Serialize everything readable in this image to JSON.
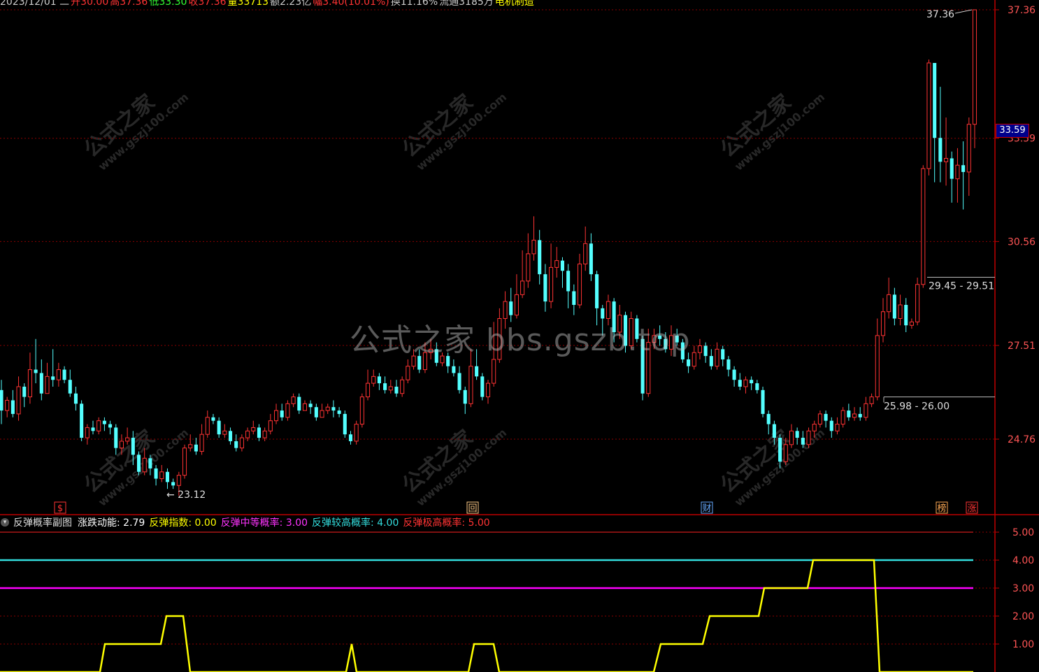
{
  "top_strip": [
    {
      "text": "2023/12/01 二",
      "color": "#cccccc"
    },
    {
      "text": "开30.00",
      "color": "#ff3333"
    },
    {
      "text": "高37.36",
      "color": "#ff3333"
    },
    {
      "text": "低33.30",
      "color": "#33ff33"
    },
    {
      "text": "收37.36",
      "color": "#ff3333"
    },
    {
      "text": "量33713",
      "color": "#ffff00"
    },
    {
      "text": "额2.23亿",
      "color": "#cccccc"
    },
    {
      "text": "幅3.40(10.01%)",
      "color": "#ff3333"
    },
    {
      "text": "换11.16%",
      "color": "#cccccc"
    },
    {
      "text": "流通3185万",
      "color": "#cccccc"
    },
    {
      "text": "电机制造",
      "color": "#ffff00"
    }
  ],
  "watermark": {
    "main": "公式之家 bbs.gszb.top",
    "tile_cn": "公式之家",
    "tile_url": "www.gszj100.com"
  },
  "price_axis": {
    "ticks": [
      "37.36",
      "33.59",
      "30.56",
      "27.51",
      "24.76"
    ],
    "current_price": "33.59"
  },
  "annotations": {
    "high": "37.36",
    "low": "23.12",
    "range_upper": "29.45 - 29.51",
    "range_lower": "25.98 - 26.00"
  },
  "markers": [
    {
      "label": "$",
      "color": "#ff3333"
    },
    {
      "label": "回",
      "color": "#ffcc88"
    },
    {
      "label": "财",
      "color": "#66aaff"
    },
    {
      "label": "榜",
      "color": "#ffaa55"
    },
    {
      "label": "涨",
      "color": "#ff3333"
    }
  ],
  "indicator": {
    "name": "反弹概率副图",
    "items": [
      {
        "label": "涨跌动能:",
        "value": "2.79",
        "color": "#ffffff"
      },
      {
        "label": "反弹指数:",
        "value": "0.00",
        "color": "#ffff00"
      },
      {
        "label": "反弹中等概率:",
        "value": "3.00",
        "color": "#ff33ff"
      },
      {
        "label": "反弹较高概率:",
        "value": "4.00",
        "color": "#33dddd"
      },
      {
        "label": "反弹极高概率:",
        "value": "5.00",
        "color": "#ff3333"
      }
    ],
    "axis_ticks": [
      "5.00",
      "4.00",
      "3.00",
      "2.00",
      "1.00"
    ]
  },
  "colors": {
    "up": "#ff3333",
    "down": "#54ffff",
    "grid": "#8b0000",
    "axis": "#c00000",
    "index_line": "#ffff00",
    "magenta": "#ff00ff",
    "cyan": "#33dddd"
  },
  "chart_data": [
    {
      "type": "candlestick",
      "title": "",
      "ylim": [
        22.2,
        37.7
      ],
      "y_ticks": [
        37.36,
        33.59,
        30.56,
        27.51,
        24.76
      ],
      "grid": true,
      "candles": [
        [
          26.2,
          25.6,
          26.5,
          25.2
        ],
        [
          25.6,
          25.9,
          26.0,
          25.4
        ],
        [
          25.9,
          25.5,
          26.2,
          25.4
        ],
        [
          25.5,
          26.3,
          26.6,
          25.3
        ],
        [
          26.3,
          26.0,
          26.4,
          25.7
        ],
        [
          26.0,
          26.8,
          27.3,
          25.8
        ],
        [
          26.8,
          26.7,
          27.7,
          26.4
        ],
        [
          26.7,
          26.1,
          27.1,
          25.9
        ],
        [
          26.1,
          26.6,
          27.0,
          26.1
        ],
        [
          26.6,
          26.5,
          27.4,
          26.3
        ],
        [
          26.5,
          26.8,
          27.0,
          26.3
        ],
        [
          26.8,
          26.5,
          26.9,
          26.4
        ],
        [
          26.5,
          26.1,
          26.8,
          26.0
        ],
        [
          26.1,
          25.8,
          26.3,
          25.6
        ],
        [
          25.8,
          24.8,
          25.9,
          24.7
        ],
        [
          24.8,
          25.1,
          25.2,
          24.6
        ],
        [
          25.1,
          25.0,
          25.3,
          24.9
        ],
        [
          25.0,
          25.3,
          25.4,
          24.9
        ],
        [
          25.3,
          25.2,
          25.4,
          25.0
        ],
        [
          25.2,
          25.1,
          25.3,
          24.9
        ],
        [
          25.1,
          24.5,
          25.2,
          24.3
        ],
        [
          24.5,
          24.7,
          24.9,
          24.3
        ],
        [
          24.7,
          24.8,
          25.1,
          24.6
        ],
        [
          24.8,
          24.3,
          25.0,
          24.0
        ],
        [
          24.3,
          23.8,
          24.4,
          23.7
        ],
        [
          23.8,
          24.2,
          24.5,
          23.7
        ],
        [
          24.2,
          23.9,
          24.3,
          23.7
        ],
        [
          23.9,
          23.6,
          24.0,
          23.4
        ],
        [
          23.6,
          23.8,
          24.0,
          23.5
        ],
        [
          23.8,
          23.5,
          23.9,
          23.3
        ],
        [
          23.5,
          23.4,
          23.6,
          23.3
        ],
        [
          23.4,
          23.7,
          23.8,
          23.1
        ],
        [
          23.7,
          24.5,
          24.6,
          23.6
        ],
        [
          24.5,
          24.6,
          24.9,
          24.4
        ],
        [
          24.6,
          24.4,
          24.8,
          24.3
        ],
        [
          24.4,
          24.9,
          25.2,
          24.3
        ],
        [
          24.9,
          25.4,
          25.6,
          24.8
        ],
        [
          25.4,
          25.3,
          25.5,
          25.2
        ],
        [
          25.3,
          24.9,
          25.4,
          24.8
        ],
        [
          24.9,
          25.0,
          25.2,
          24.8
        ],
        [
          25.0,
          24.7,
          25.1,
          24.6
        ],
        [
          24.7,
          24.5,
          24.9,
          24.4
        ],
        [
          24.5,
          24.8,
          24.9,
          24.4
        ],
        [
          24.8,
          25.0,
          25.1,
          24.7
        ],
        [
          25.0,
          25.1,
          25.3,
          24.9
        ],
        [
          25.1,
          24.8,
          25.2,
          24.7
        ],
        [
          24.8,
          25.0,
          25.1,
          24.7
        ],
        [
          25.0,
          25.3,
          25.5,
          24.9
        ],
        [
          25.3,
          25.6,
          25.8,
          25.2
        ],
        [
          25.6,
          25.4,
          25.8,
          25.3
        ],
        [
          25.4,
          25.8,
          25.9,
          25.3
        ],
        [
          25.8,
          26.0,
          26.1,
          25.7
        ],
        [
          26.0,
          25.6,
          26.1,
          25.5
        ],
        [
          25.6,
          25.8,
          25.9,
          25.6
        ],
        [
          25.8,
          25.7,
          25.9,
          25.5
        ],
        [
          25.7,
          25.4,
          25.8,
          25.3
        ],
        [
          25.4,
          25.6,
          25.8,
          25.4
        ],
        [
          25.6,
          25.7,
          25.8,
          25.5
        ],
        [
          25.7,
          25.6,
          25.9,
          25.4
        ],
        [
          25.6,
          25.5,
          25.7,
          25.4
        ],
        [
          25.5,
          24.9,
          25.6,
          24.8
        ],
        [
          24.9,
          24.7,
          25.0,
          24.6
        ],
        [
          24.7,
          25.2,
          25.3,
          24.6
        ],
        [
          25.2,
          26.0,
          26.1,
          25.1
        ],
        [
          26.0,
          26.4,
          26.8,
          25.9
        ],
        [
          26.4,
          26.6,
          26.8,
          26.3
        ],
        [
          26.6,
          26.4,
          26.7,
          26.2
        ],
        [
          26.4,
          26.2,
          26.6,
          26.1
        ],
        [
          26.2,
          26.3,
          26.5,
          26.1
        ],
        [
          26.3,
          26.1,
          26.5,
          26.0
        ],
        [
          26.1,
          26.5,
          26.6,
          26.0
        ],
        [
          26.5,
          26.9,
          27.1,
          26.4
        ],
        [
          26.9,
          27.2,
          27.4,
          26.8
        ],
        [
          27.2,
          26.8,
          27.4,
          26.7
        ],
        [
          26.8,
          27.3,
          27.6,
          26.7
        ],
        [
          27.3,
          27.4,
          27.7,
          27.1
        ],
        [
          27.4,
          27.0,
          27.6,
          26.9
        ],
        [
          27.0,
          27.2,
          27.3,
          26.9
        ],
        [
          27.2,
          26.9,
          27.3,
          26.7
        ],
        [
          26.9,
          26.7,
          27.1,
          26.6
        ],
        [
          26.7,
          26.2,
          26.9,
          26.1
        ],
        [
          26.2,
          25.8,
          26.3,
          25.5
        ],
        [
          25.8,
          26.9,
          27.4,
          25.7
        ],
        [
          26.9,
          26.6,
          27.4,
          26.5
        ],
        [
          26.6,
          26.0,
          26.7,
          25.9
        ],
        [
          26.0,
          26.4,
          26.5,
          25.8
        ],
        [
          26.4,
          27.1,
          28.2,
          26.3
        ],
        [
          27.1,
          28.3,
          28.6,
          27.0
        ],
        [
          28.3,
          28.8,
          29.1,
          28.0
        ],
        [
          28.8,
          28.4,
          29.2,
          28.2
        ],
        [
          28.4,
          29.0,
          29.6,
          28.3
        ],
        [
          29.0,
          29.4,
          30.3,
          28.9
        ],
        [
          29.4,
          30.2,
          30.8,
          29.2
        ],
        [
          30.2,
          30.6,
          31.3,
          30.0
        ],
        [
          30.6,
          29.6,
          30.9,
          29.3
        ],
        [
          29.6,
          28.8,
          29.9,
          28.5
        ],
        [
          28.8,
          29.8,
          30.5,
          28.6
        ],
        [
          29.8,
          30.0,
          30.4,
          29.5
        ],
        [
          30.0,
          29.7,
          30.1,
          29.2
        ],
        [
          29.7,
          29.1,
          29.9,
          28.6
        ],
        [
          29.1,
          28.7,
          29.3,
          28.4
        ],
        [
          28.7,
          29.9,
          30.2,
          28.6
        ],
        [
          29.9,
          30.5,
          31.0,
          29.7
        ],
        [
          30.5,
          29.6,
          30.8,
          29.4
        ],
        [
          29.6,
          28.6,
          29.7,
          28.1
        ],
        [
          28.6,
          28.3,
          28.7,
          27.8
        ],
        [
          28.3,
          28.8,
          29.0,
          28.1
        ],
        [
          28.8,
          27.9,
          28.9,
          27.6
        ],
        [
          27.9,
          28.4,
          28.7,
          27.7
        ],
        [
          28.4,
          27.5,
          28.5,
          27.3
        ],
        [
          27.5,
          28.3,
          28.5,
          27.4
        ],
        [
          28.3,
          27.7,
          28.4,
          27.6
        ],
        [
          27.7,
          26.1,
          27.8,
          25.9
        ],
        [
          26.1,
          27.6,
          28.0,
          26.0
        ],
        [
          27.6,
          27.8,
          28.0,
          27.4
        ],
        [
          27.8,
          27.7,
          28.1,
          27.5
        ],
        [
          27.7,
          27.4,
          27.9,
          27.3
        ],
        [
          27.4,
          27.8,
          28.1,
          27.2
        ],
        [
          27.8,
          27.6,
          28.0,
          27.5
        ],
        [
          27.6,
          27.1,
          27.7,
          27.0
        ],
        [
          27.1,
          26.9,
          27.3,
          26.7
        ],
        [
          26.9,
          27.3,
          27.5,
          26.8
        ],
        [
          27.3,
          27.5,
          27.7,
          27.1
        ],
        [
          27.5,
          27.2,
          27.6,
          27.0
        ],
        [
          27.2,
          26.9,
          27.4,
          26.8
        ],
        [
          26.9,
          27.4,
          27.6,
          26.8
        ],
        [
          27.4,
          27.1,
          27.5,
          26.9
        ],
        [
          27.1,
          26.8,
          27.2,
          26.6
        ],
        [
          26.8,
          26.5,
          26.9,
          26.3
        ],
        [
          26.5,
          26.3,
          26.7,
          26.2
        ],
        [
          26.3,
          26.5,
          26.6,
          26.1
        ],
        [
          26.5,
          26.4,
          26.6,
          26.2
        ],
        [
          26.4,
          26.2,
          26.5,
          26.1
        ],
        [
          26.2,
          25.5,
          26.3,
          25.4
        ],
        [
          25.5,
          25.2,
          25.6,
          24.9
        ],
        [
          25.2,
          24.8,
          25.3,
          24.6
        ],
        [
          24.8,
          24.1,
          24.9,
          23.9
        ],
        [
          24.1,
          24.6,
          24.8,
          24.0
        ],
        [
          24.6,
          25.0,
          25.2,
          24.5
        ],
        [
          25.0,
          24.8,
          25.1,
          24.6
        ],
        [
          24.8,
          24.6,
          25.0,
          24.5
        ],
        [
          24.6,
          25.0,
          25.1,
          24.5
        ],
        [
          25.0,
          25.2,
          25.3,
          24.8
        ],
        [
          25.2,
          25.5,
          25.6,
          25.1
        ],
        [
          25.5,
          25.3,
          25.6,
          25.1
        ],
        [
          25.3,
          25.0,
          25.4,
          24.8
        ],
        [
          25.0,
          25.2,
          25.4,
          24.9
        ],
        [
          25.2,
          25.6,
          25.7,
          25.1
        ],
        [
          25.6,
          25.4,
          25.8,
          25.3
        ],
        [
          25.4,
          25.5,
          25.7,
          25.3
        ],
        [
          25.5,
          25.4,
          25.7,
          25.3
        ],
        [
          25.4,
          25.8,
          26.0,
          25.3
        ],
        [
          25.8,
          26.0,
          26.1,
          25.7
        ],
        [
          26.0,
          27.8,
          28.3,
          25.9
        ],
        [
          27.8,
          28.5,
          28.9,
          27.6
        ],
        [
          28.5,
          29.0,
          29.5,
          28.3
        ],
        [
          29.0,
          28.3,
          29.2,
          28.1
        ],
        [
          28.3,
          28.7,
          29.0,
          28.1
        ],
        [
          28.7,
          28.1,
          28.9,
          27.9
        ],
        [
          28.1,
          28.2,
          28.3,
          28.0
        ],
        [
          28.2,
          29.3,
          29.5,
          28.1
        ],
        [
          29.3,
          32.7,
          32.8,
          29.2
        ],
        [
          32.7,
          35.8,
          35.9,
          32.5
        ],
        [
          35.8,
          33.6,
          35.8,
          32.3
        ],
        [
          33.6,
          32.9,
          35.1,
          32.3
        ],
        [
          32.9,
          33.0,
          34.2,
          32.2
        ],
        [
          33.0,
          32.4,
          33.2,
          31.7
        ],
        [
          32.4,
          32.8,
          33.3,
          31.7
        ],
        [
          32.8,
          32.6,
          33.5,
          31.5
        ],
        [
          32.6,
          34.0,
          34.2,
          31.9
        ],
        [
          34.0,
          37.36,
          37.36,
          33.3
        ]
      ]
    },
    {
      "type": "line",
      "title": "反弹概率副图",
      "ylim": [
        0,
        5.5
      ],
      "y_ticks": [
        5,
        4,
        3,
        2,
        1
      ],
      "grid": true,
      "series": [
        {
          "name": "反弹极高概率",
          "type": "constant",
          "value": 5.0
        },
        {
          "name": "反弹较高概率",
          "type": "constant",
          "value": 4.0
        },
        {
          "name": "反弹中等概率",
          "type": "constant",
          "value": 3.0
        },
        {
          "name": "反弹指数",
          "type": "step",
          "x": [
            0,
            143,
            150,
            230,
            238,
            262,
            272,
            495,
            503,
            510,
            670,
            678,
            706,
            714,
            935,
            945,
            1005,
            1015,
            1085,
            1093,
            1155,
            1163,
            1250,
            1258,
            1392
          ],
          "values": [
            0,
            0,
            1,
            1,
            2,
            2,
            0,
            0,
            1,
            0,
            0,
            1,
            1,
            0,
            0,
            1,
            1,
            2,
            2,
            3,
            3,
            4,
            4,
            0,
            0
          ]
        }
      ]
    }
  ]
}
